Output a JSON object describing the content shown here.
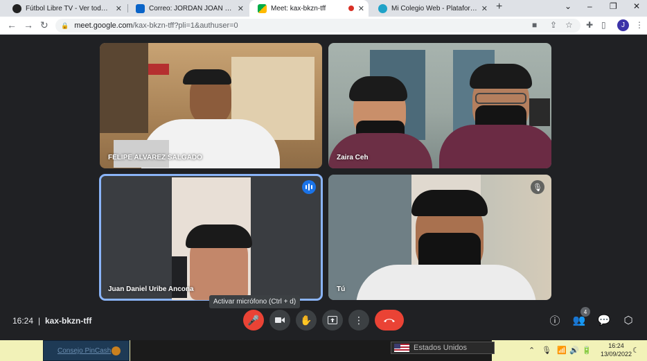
{
  "browser": {
    "tabs": [
      {
        "title": "Fútbol Libre TV - Ver todos los p",
        "favicon_color": "#222222",
        "favicon": "soccer-ball-icon"
      },
      {
        "title": "Correo: JORDAN JOAN CAHUICH",
        "favicon_color": "#0a64c8",
        "favicon": "outlook-icon"
      },
      {
        "title": "Meet: kax-bkzn-tff",
        "favicon_color": "#00897b",
        "favicon": "meet-icon",
        "active": true
      },
      {
        "title": "Mi Colegio Web - Plataforma de",
        "favicon_color": "#1fa2c8",
        "favicon": "colegio-icon"
      }
    ],
    "url": {
      "host": "meet.google.com",
      "path": "/kax-bkzn-tff?pli=1&authuser=0"
    },
    "profile_initial": "J"
  },
  "meet": {
    "participants": [
      {
        "name": "FELIPE ALVAREZ SALGADO"
      },
      {
        "name": "Zaira Ceh"
      },
      {
        "name": "Juan Daniel Uribe Ancona",
        "speaking": true
      },
      {
        "name": "Tú",
        "muted": true
      }
    ],
    "tooltip": "Activar micrófono (Ctrl + d)",
    "time": "16:24",
    "separator": "|",
    "meeting_code": "kax-bkzn-tff",
    "participant_count": "4",
    "colors": {
      "end_call": "#ea4335",
      "speaking_outline": "#8ab4f8",
      "mic_off": "#ea4335"
    }
  },
  "taskbar": {
    "left_link": "Consejo PinCash",
    "country": "Estados Unidos",
    "clock_time": "16:24",
    "clock_date": "13/09/2022"
  }
}
